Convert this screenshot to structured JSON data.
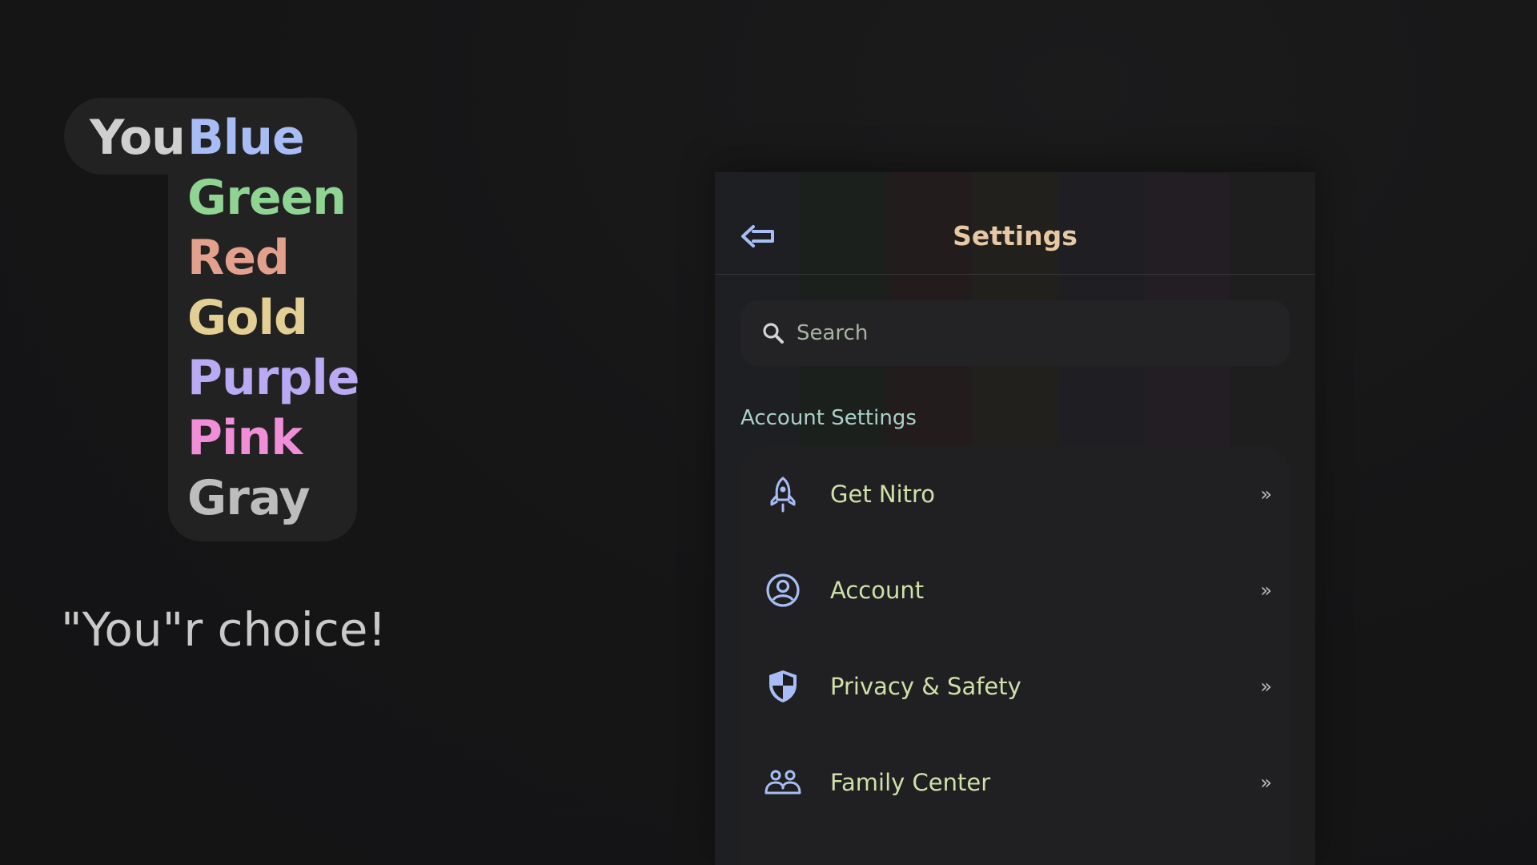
{
  "palette": {
    "you_label": "You",
    "colors": [
      {
        "label": "Blue",
        "color": "#a8bdf5"
      },
      {
        "label": "Green",
        "color": "#8fd493"
      },
      {
        "label": "Red",
        "color": "#e3a18d"
      },
      {
        "label": "Gold",
        "color": "#e3cf93"
      },
      {
        "label": "Purple",
        "color": "#b9aaf3"
      },
      {
        "label": "Pink",
        "color": "#f08ed8"
      },
      {
        "label": "Gray",
        "color": "#bdbdbd"
      }
    ]
  },
  "tagline": "\"You\"r choice!",
  "settings_panel": {
    "title": "Settings",
    "back_icon": "back-arrow-icon",
    "search": {
      "placeholder": "Search",
      "icon": "search-icon"
    },
    "section_title": "Account Settings",
    "items": [
      {
        "label": "Get Nitro",
        "icon": "rocket-icon"
      },
      {
        "label": "Account",
        "icon": "user-circle-icon"
      },
      {
        "label": "Privacy & Safety",
        "icon": "shield-icon"
      },
      {
        "label": "Family Center",
        "icon": "family-icon"
      }
    ],
    "chevron": "»",
    "stripe_colors": [
      "#1f2229",
      "#1c241f",
      "#281f1d",
      "#26241d",
      "#22212a",
      "#28202a",
      "#202021"
    ],
    "accent_color": "#a8bdf5"
  }
}
